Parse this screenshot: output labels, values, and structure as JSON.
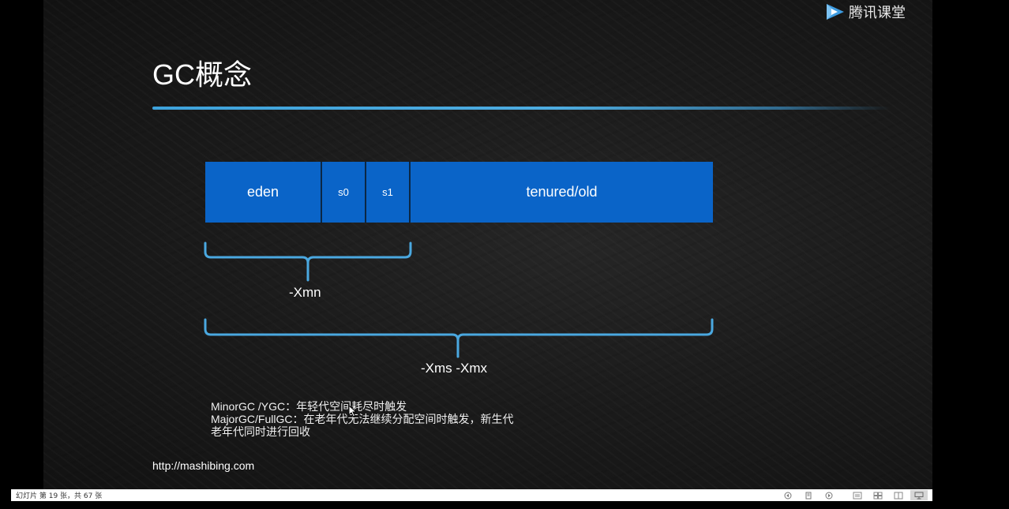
{
  "logo": {
    "text": "腾讯课堂"
  },
  "slide": {
    "title": "GC概念",
    "heap": {
      "eden": "eden",
      "s0": "s0",
      "s1": "s1",
      "old": "tenured/old"
    },
    "braces": {
      "young_label": "-Xmn",
      "heap_label": "-Xms -Xmx"
    },
    "notes": [
      "MinorGC /YGC：年轻代空间耗尽时触发",
      "MajorGC/FullGC：在老年代无法继续分配空间时触发，新生代",
      "老年代同时进行回收"
    ],
    "url": "http://mashibing.com"
  },
  "statusbar": {
    "slide_info": "幻灯片 第 19 张，共 67 张",
    "icons": [
      "prev-icon",
      "notes-icon",
      "next-icon",
      "normal-view-icon",
      "slide-sorter-icon",
      "reading-view-icon",
      "slideshow-icon"
    ]
  },
  "colors": {
    "heap_block": "#0a64c8",
    "accent_rule": "#40aae6",
    "brace": "#4aa8e0"
  }
}
